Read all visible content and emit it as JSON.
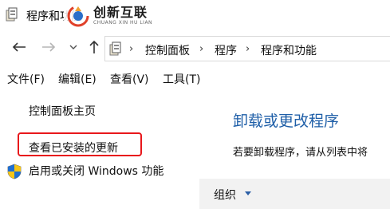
{
  "window": {
    "title": "程序和功能"
  },
  "watermark": {
    "brand": "创新互联",
    "sub": "CHUANG XIN HU LIAN"
  },
  "nav": {
    "back": "←",
    "forward": "→",
    "recent": "⌄",
    "up": "↑"
  },
  "breadcrumb": {
    "items": [
      "控制面板",
      "程序",
      "程序和功能"
    ],
    "separator": "›"
  },
  "menu": {
    "items": [
      "文件(F)",
      "编辑(E)",
      "查看(V)",
      "工具(T)"
    ]
  },
  "sidebar": {
    "home": "控制面板主页",
    "view_updates": "查看已安装的更新",
    "windows_features": "启用或关闭 Windows 功能"
  },
  "main": {
    "title": "卸载或更改程序",
    "description": "若要卸载程序，请从列表中将"
  },
  "toolbar": {
    "organize": "组织"
  },
  "colors": {
    "link_title": "#1f5fa8",
    "highlight": "#e8171b"
  }
}
